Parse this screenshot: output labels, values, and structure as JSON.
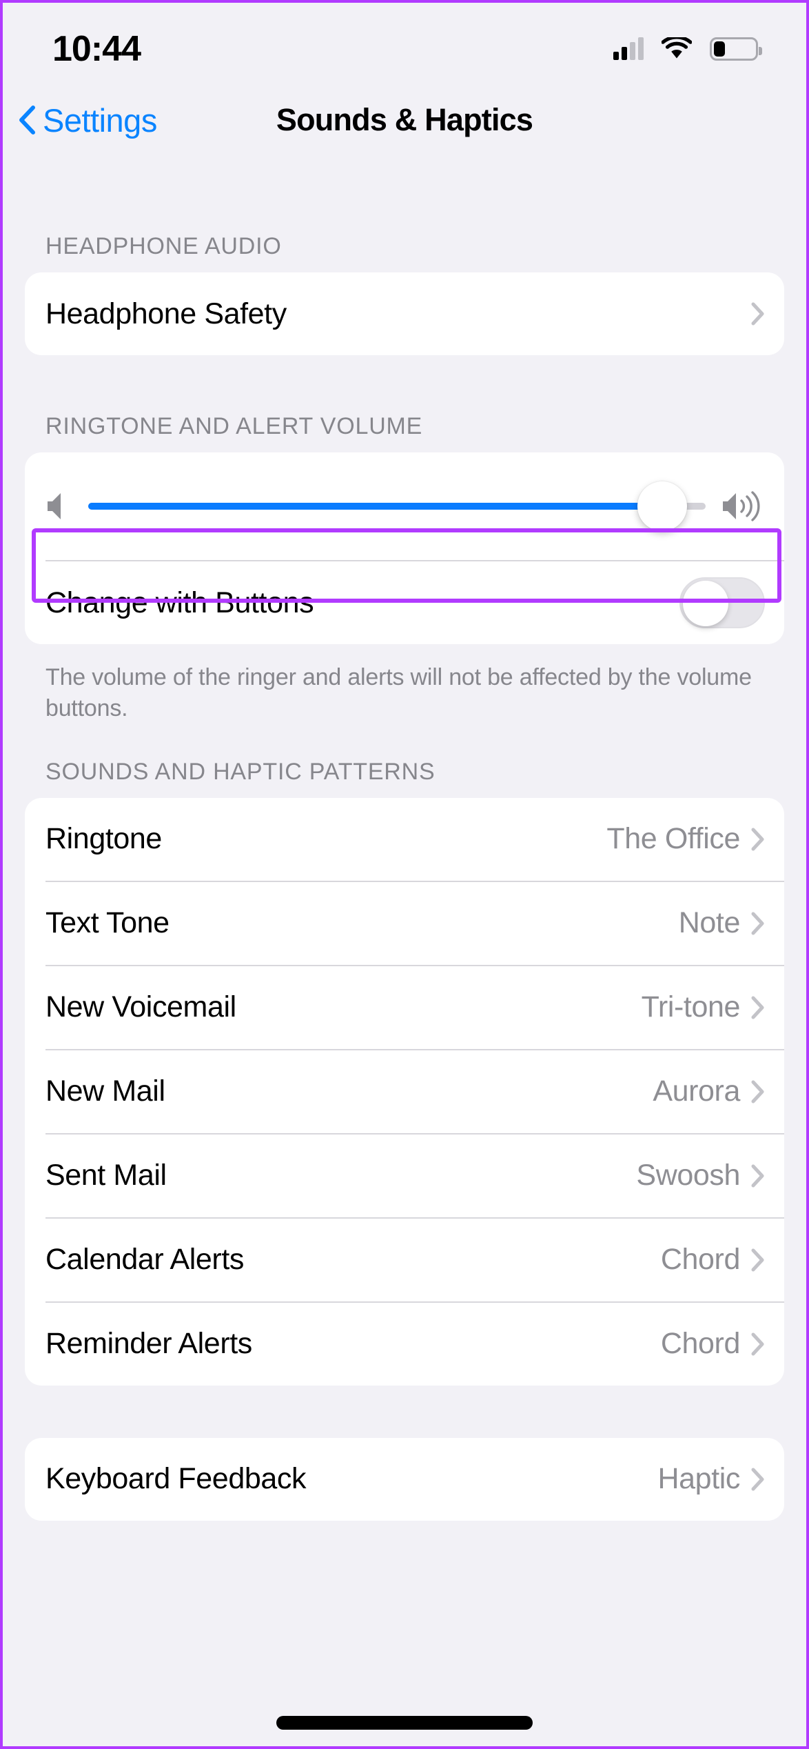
{
  "status_bar": {
    "time": "10:44",
    "cellular_icon": "cellular-signal-icon",
    "cellular_bars_filled": 2,
    "cellular_bars_total": 4,
    "wifi_icon": "wifi-icon",
    "battery_icon": "battery-icon",
    "battery_level_percent": 28
  },
  "nav": {
    "back_label": "Settings",
    "back_icon": "chevron-left-icon",
    "title": "Sounds & Haptics"
  },
  "colors": {
    "accent_blue": "#0a84ff",
    "slider_blue": "#0a7cff",
    "highlight_purple": "#b13bff",
    "page_background": "#f2f1f6",
    "card_background": "#ffffff",
    "secondary_text": "#8e8e93"
  },
  "sections": [
    {
      "header": "HEADPHONE AUDIO",
      "rows": [
        {
          "label": "Headphone Safety",
          "value": "",
          "accessory": "chevron-right-icon"
        }
      ]
    },
    {
      "header": "RINGTONE AND ALERT VOLUME",
      "slider": {
        "name": "ringtone-alert-volume-slider",
        "value_percent": 93,
        "min_icon": "speaker-low-icon",
        "max_icon": "speaker-high-icon"
      },
      "toggle_row": {
        "label": "Change with Buttons",
        "toggle_name": "change-with-buttons-toggle",
        "state": "off"
      },
      "footnote": "The volume of the ringer and alerts will not be affected by the volume buttons."
    },
    {
      "header": "SOUNDS AND HAPTIC PATTERNS",
      "rows": [
        {
          "label": "Ringtone",
          "value": "The Office",
          "accessory": "chevron-right-icon"
        },
        {
          "label": "Text Tone",
          "value": "Note",
          "accessory": "chevron-right-icon"
        },
        {
          "label": "New Voicemail",
          "value": "Tri-tone",
          "accessory": "chevron-right-icon"
        },
        {
          "label": "New Mail",
          "value": "Aurora",
          "accessory": "chevron-right-icon"
        },
        {
          "label": "Sent Mail",
          "value": "Swoosh",
          "accessory": "chevron-right-icon"
        },
        {
          "label": "Calendar Alerts",
          "value": "Chord",
          "accessory": "chevron-right-icon"
        },
        {
          "label": "Reminder Alerts",
          "value": "Chord",
          "accessory": "chevron-right-icon"
        }
      ]
    },
    {
      "header": "",
      "rows": [
        {
          "label": "Keyboard Feedback",
          "value": "Haptic",
          "accessory": "chevron-right-icon"
        }
      ]
    }
  ]
}
